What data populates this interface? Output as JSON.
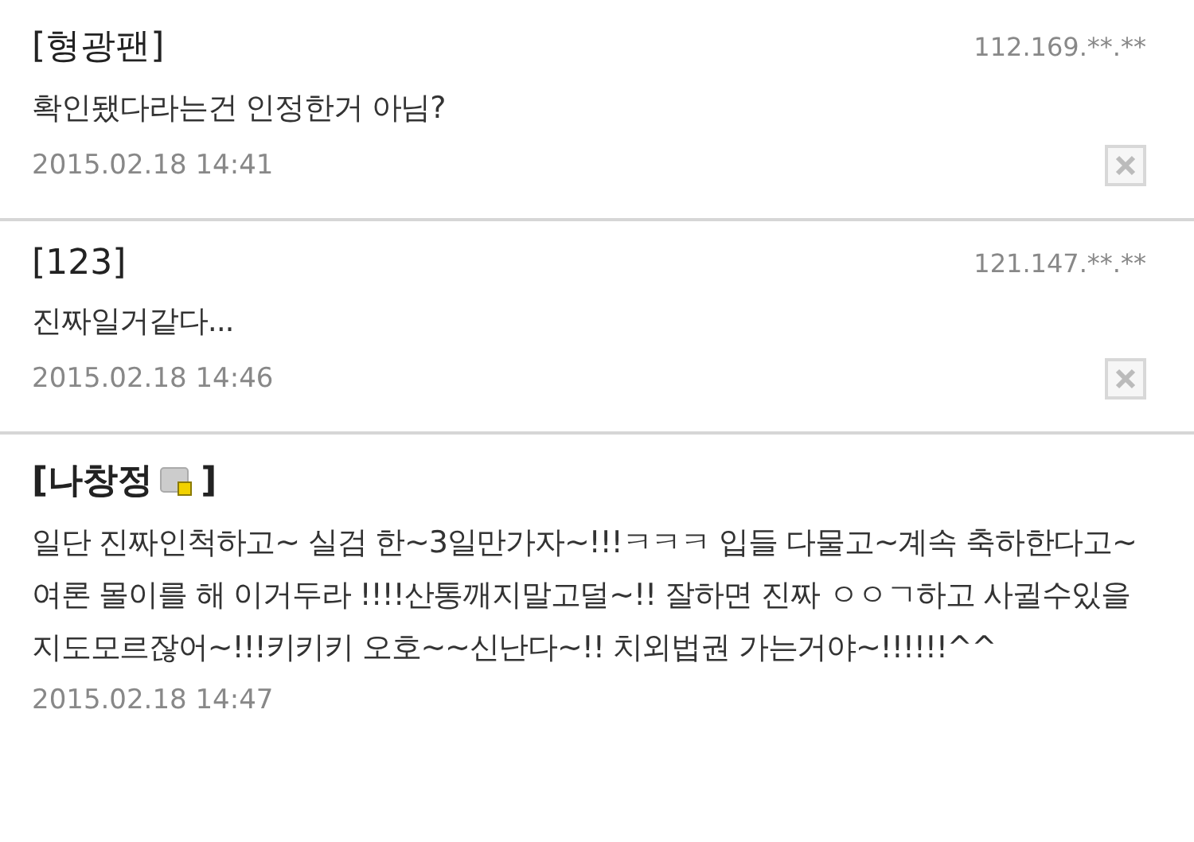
{
  "comments": [
    {
      "author": "[형광팬]",
      "author_bold": false,
      "badge": false,
      "ip": "112.169.**.**",
      "body": "확인됐다라는건 인정한거 아님?",
      "date": "2015.02.18 14:41",
      "deletable": true
    },
    {
      "author": "[123]",
      "author_bold": false,
      "badge": false,
      "ip": "121.147.**.**",
      "body": "진짜일거같다...",
      "date": "2015.02.18 14:46",
      "deletable": true
    },
    {
      "author": "[나창정",
      "author_close": "]",
      "author_bold": true,
      "badge": true,
      "body": "일단 진짜인척하고~ 실검 한~3일만가자~!!!ㅋㅋㅋ 입들 다물고~계속 축하한다고~여론 몰이를 해 이거두라 !!!!산통깨지말고덜~!! 잘하면 진짜 ㅇㅇㄱ하고 사귈수있을지도모르잖어~!!!키키키 오호~~신난다~!! 치외법권 가는거야~!!!!!!^^",
      "date": "2015.02.18 14:47",
      "deletable": false
    }
  ]
}
